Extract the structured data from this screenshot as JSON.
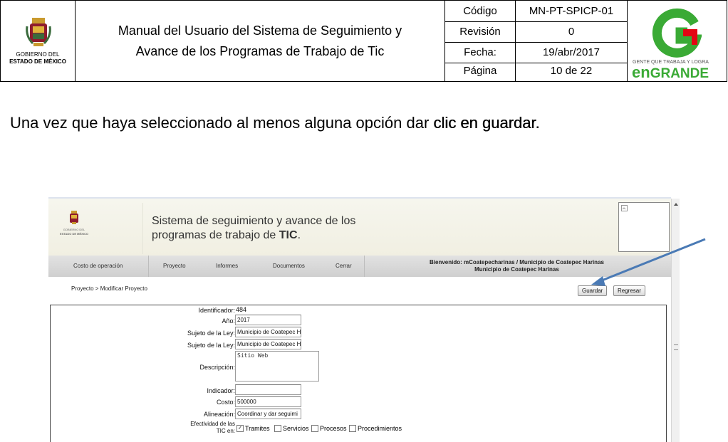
{
  "header": {
    "org_lines": [
      "GOBIERNO DEL",
      "ESTADO DE MÉXICO"
    ],
    "title_line1": "Manual del Usuario del Sistema de Seguimiento y",
    "title_line2": "Avance de los Programas de Trabajo de Tic",
    "meta": [
      {
        "key": "Código",
        "value": "MN-PT-SPICP-01"
      },
      {
        "key": "Revisión",
        "value": "0"
      },
      {
        "key": "Fecha:",
        "value": "19/abr/2017"
      },
      {
        "key": "Página",
        "value": "10 de 22"
      }
    ],
    "brand_tagline": "GENTE QUE TRABAJA Y LOGRA",
    "brand_prefix": "en",
    "brand_word": "GRANDE",
    "brand_color": "#3aaa35",
    "brand_red": "#e30613"
  },
  "instruction": {
    "text": "Una vez que haya seleccionado al menos alguna opción dar ",
    "bold": "clic en guardar."
  },
  "app": {
    "org_lines": [
      "GOBIERNO DEL",
      "ESTADO DE MÉXICO"
    ],
    "title_line1": "Sistema de seguimiento y avance de los",
    "title_line2_pre": "programas de trabajo de ",
    "title_line2_bold": "TIC",
    "title_line2_post": ".",
    "nav": [
      "Costo de operación",
      "Proyecto",
      "Informes",
      "Documentos",
      "Cerrar"
    ],
    "welcome_line1": "Bienvenido: mCoatepecharinas / Municipio de Coatepec Harinas",
    "welcome_line2": "Municipio de Coatepec Harinas",
    "breadcrumb": "Proyecto > Modificar Proyecto",
    "save_label": "Guardar",
    "back_label": "Regresar",
    "form": {
      "id_label": "Identificador:",
      "id_value": "484",
      "year_label": "Año:",
      "year_value": "2017",
      "subject1_label": "Sujeto de la Ley:",
      "subject1_value": "Municipio de Coatepec H",
      "subject2_label": "Sujeto de la Ley:",
      "subject2_value": "Municipio de Coatepec H",
      "desc_label": "Descripción:",
      "desc_value": "Sitio Web",
      "indicator_label": "Indicador:",
      "indicator_value": "",
      "cost_label": "Costo:",
      "cost_value": "500000",
      "align_label": "Alineación:",
      "align_value": "Coordinar y dar seguimi",
      "eff_label_1": "Efectividad de las",
      "eff_label_2": "TIC en:",
      "options": [
        {
          "label": "Tramites",
          "checked": true
        },
        {
          "label": "Servicios",
          "checked": false
        },
        {
          "label": "Procesos",
          "checked": false
        },
        {
          "label": "Procedimientos",
          "checked": false
        }
      ]
    }
  }
}
